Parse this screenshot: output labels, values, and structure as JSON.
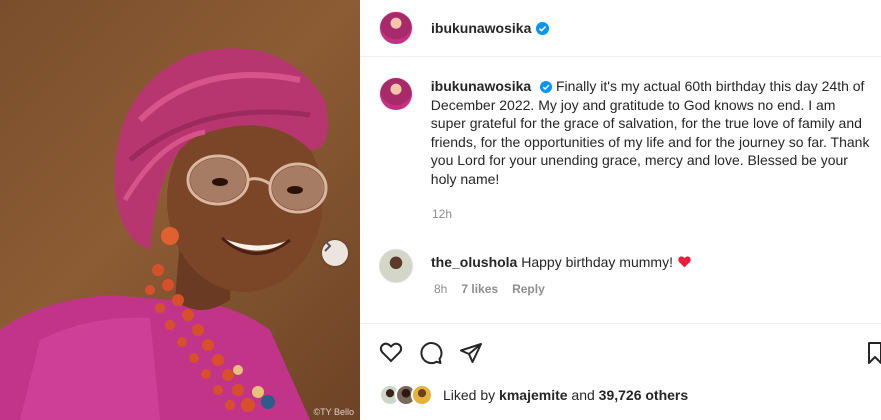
{
  "post": {
    "image_credit": "©TY Bello",
    "author": "ibukunawosika",
    "caption_author": "ibukunawosika",
    "caption_text": "Finally it's my actual 60th birthday this day 24th of December 2022. My joy and gratitude to God knows no end. I am super grateful for the grace of salvation, for the true love of family and friends, for the opportunities of my life and for the journey so far. Thank you Lord for your unending grace, mercy and love. Blessed be your holy name!",
    "caption_time": "12h"
  },
  "comment": {
    "user": "the_olushola",
    "text": "Happy birthday mummy!",
    "emoji": "❤️",
    "time": "8h",
    "likes": "7 likes",
    "reply_label": "Reply"
  },
  "likes": {
    "prefix": "Liked by",
    "user": "kmajemite",
    "joiner": "and",
    "others": "39,726 others"
  },
  "colors": {
    "verified": "#0095f6",
    "heart": "#ed1c3c",
    "muted": "#8e8e8e"
  }
}
